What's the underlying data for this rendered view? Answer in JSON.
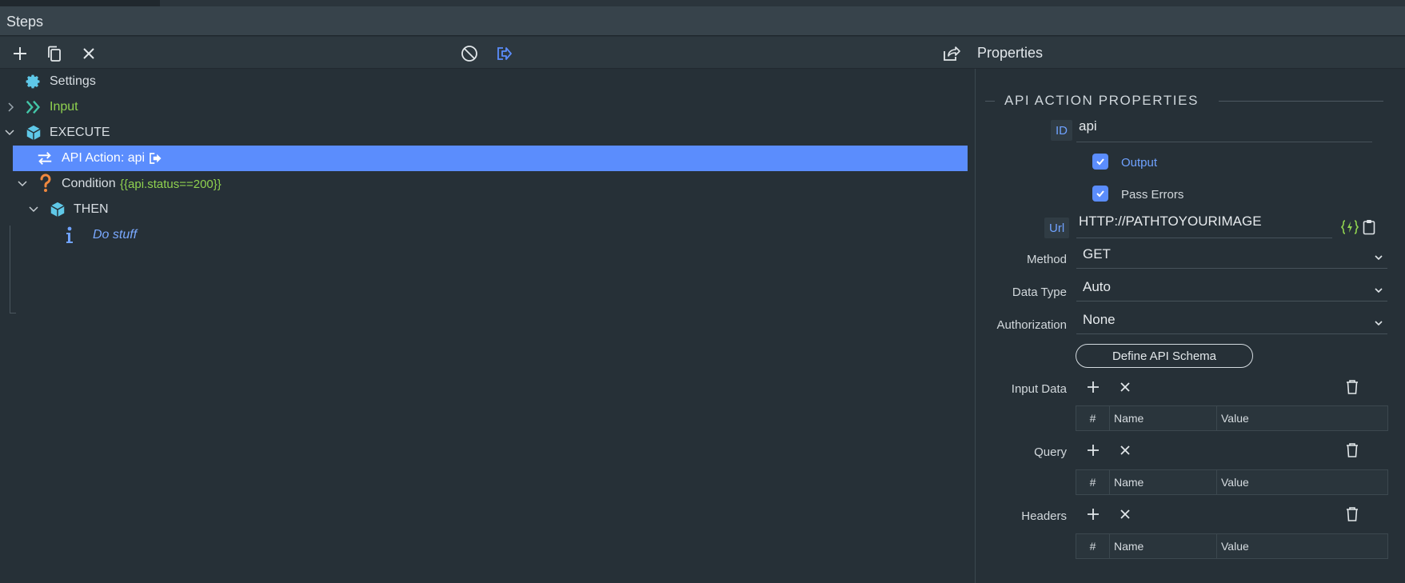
{
  "window": {
    "title": "Steps"
  },
  "toolbar": {
    "properties_title": "Properties"
  },
  "tree": {
    "settings": "Settings",
    "input": "Input",
    "execute": "EXECUTE",
    "api_action": "API Action: api",
    "condition": "Condition",
    "condition_expr": "{{api.status==200}}",
    "then": "THEN",
    "do_stuff": "Do stuff"
  },
  "properties": {
    "section_title": "API ACTION PROPERTIES",
    "id_badge": "ID",
    "id_value": "api",
    "output_label": "Output",
    "pass_errors_label": "Pass Errors",
    "url_badge": "Url",
    "url_value": "HTTP://PATHTOYOURIMAGE",
    "method_label": "Method",
    "method_value": "GET",
    "data_type_label": "Data Type",
    "data_type_value": "Auto",
    "authorization_label": "Authorization",
    "authorization_value": "None",
    "define_schema_button": "Define API Schema",
    "input_data_label": "Input Data",
    "query_label": "Query",
    "headers_label": "Headers",
    "grid_cols": {
      "index": "#",
      "name": "Name",
      "value": "Value"
    }
  },
  "colors": {
    "accent": "#5b8dfd",
    "green": "#8fd14f",
    "orange": "#f0883e",
    "cyan": "#5fc8e8"
  }
}
